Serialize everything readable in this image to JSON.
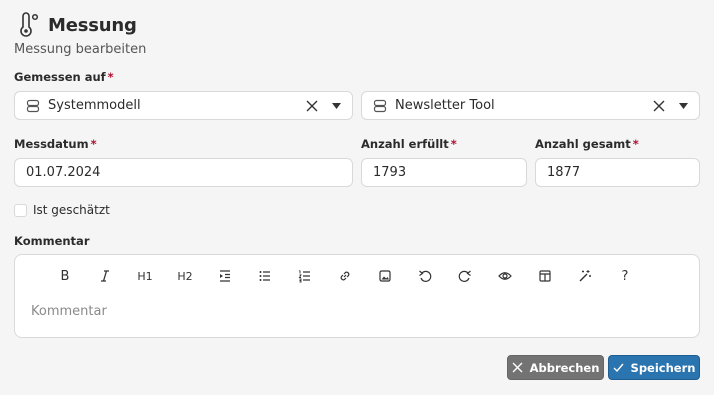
{
  "header": {
    "title": "Messung",
    "subtitle": "Messung bearbeiten",
    "icon": "thermometer-icon"
  },
  "fields": {
    "measured_on_label": "Gemessen auf",
    "select_1": {
      "value": "Systemmodell"
    },
    "select_2": {
      "value": "Newsletter Tool"
    },
    "date_label": "Messdatum",
    "date_value": "01.07.2024",
    "fulfilled_label": "Anzahl erfüllt",
    "fulfilled_value": "1793",
    "total_label": "Anzahl gesamt",
    "total_value": "1877",
    "estimated_label": "Ist geschätzt",
    "comment_label": "Kommentar",
    "comment_placeholder": "Kommentar",
    "required_mark": "*"
  },
  "toolbar": {
    "bold": "B",
    "h1": "H1",
    "h2": "H2",
    "help": "?"
  },
  "buttons": {
    "cancel": "Abbrechen",
    "save": "Speichern"
  },
  "colors": {
    "required": "#b01030",
    "save": "#2a74b0",
    "cancel": "#737373"
  }
}
